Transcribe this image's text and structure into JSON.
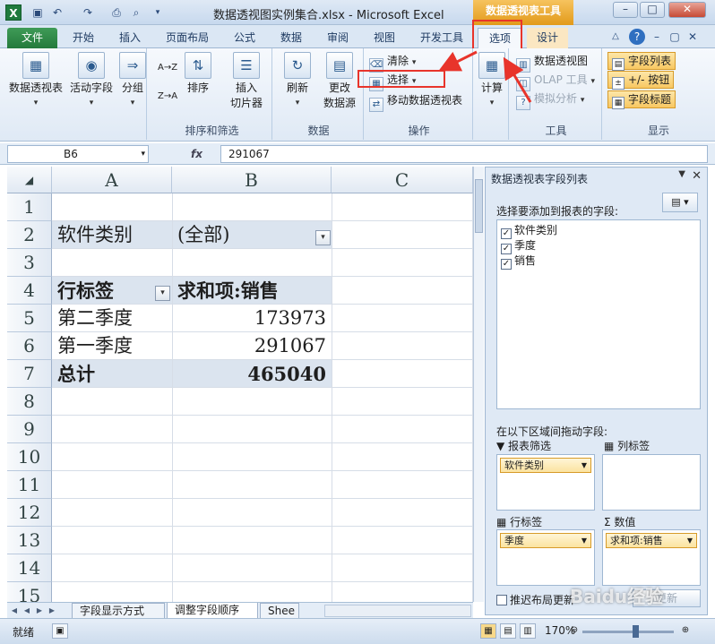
{
  "window": {
    "title": "数据透视图实例集合.xlsx - Microsoft Excel",
    "context_group": "数据透视表工具",
    "app_icon_letter": "X",
    "controls": {
      "minimize": "–",
      "maximize": "□",
      "close": "✕"
    }
  },
  "quick_access": {
    "save_icon": "save-icon",
    "undo_icon": "undo-icon",
    "redo_icon": "redo-icon",
    "print_icon": "print-icon",
    "preview_icon": "preview-icon"
  },
  "tabs": {
    "file": "文件",
    "home": "开始",
    "insert": "插入",
    "page_layout": "页面布局",
    "formulas": "公式",
    "data": "数据",
    "review": "审阅",
    "view": "视图",
    "developer": "开发工具",
    "options": "选项",
    "design": "设计"
  },
  "ribbon": {
    "pivot_table": "数据透视表",
    "active_field": "活动字段",
    "group": "分组",
    "sort_az": "A→Z",
    "sort_za": "Z→A",
    "sort": "排序",
    "insert_slicer_line1": "插入",
    "insert_slicer_line2": "切片器",
    "sort_filter_group": "排序和筛选",
    "refresh": "刷新",
    "change_source_line1": "更改",
    "change_source_line2": "数据源",
    "data_group": "数据",
    "clear": "清除",
    "select": "选择",
    "move_pivot": "移动数据透视表",
    "actions_group": "操作",
    "calculations": "计算",
    "pivot_chart": "数据透视图",
    "olap_tools": "OLAP 工具",
    "what_if": "模拟分析",
    "tools_group": "工具",
    "field_list": "字段列表",
    "buttons": "+/- 按钮",
    "field_headers": "字段标题",
    "show_group": "显示"
  },
  "formula_bar": {
    "name_box": "B6",
    "fx": "fx",
    "value": "291067"
  },
  "sheet": {
    "columns": [
      "A",
      "B",
      "C"
    ],
    "rows": [
      "1",
      "2",
      "3",
      "4",
      "5",
      "6",
      "7",
      "8",
      "9",
      "10",
      "11",
      "12",
      "13",
      "14",
      "15"
    ],
    "filter_label": "软件类别",
    "filter_value": "(全部)",
    "row_labels_header": "行标签",
    "sum_header": "求和项:销售",
    "data": [
      {
        "label": "第二季度",
        "value": "173973"
      },
      {
        "label": "第一季度",
        "value": "291067"
      }
    ],
    "total_label": "总计",
    "total_value": "465040"
  },
  "sheet_tabs": {
    "tab1": "字段显示方式",
    "tab2": "调整字段顺序",
    "tab3": "Shee"
  },
  "status": {
    "ready": "就绪",
    "zoom": "170%"
  },
  "field_pane": {
    "title": "数据透视表字段列表",
    "choose_label": "选择要添加到报表的字段:",
    "fields": [
      {
        "name": "软件类别",
        "checked": "✓"
      },
      {
        "name": "季度",
        "checked": "✓"
      },
      {
        "name": "销售",
        "checked": "✓"
      }
    ],
    "drag_label": "在以下区域间拖动字段:",
    "report_filter_label": "报表筛选",
    "column_labels_label": "列标签",
    "row_labels_label": "行标签",
    "values_label": "数值",
    "report_filter_chip": "软件类别",
    "row_labels_chip": "季度",
    "values_chip": "求和项:销售",
    "defer_update": "推迟布局更新",
    "update_button": "更新"
  },
  "watermark": "Baidu经验",
  "colors": {
    "annotation_red": "#e8342b",
    "file_tab_green": "#247a3b",
    "context_orange": "#e29a1a",
    "pivot_band": "#dbe4ef"
  }
}
